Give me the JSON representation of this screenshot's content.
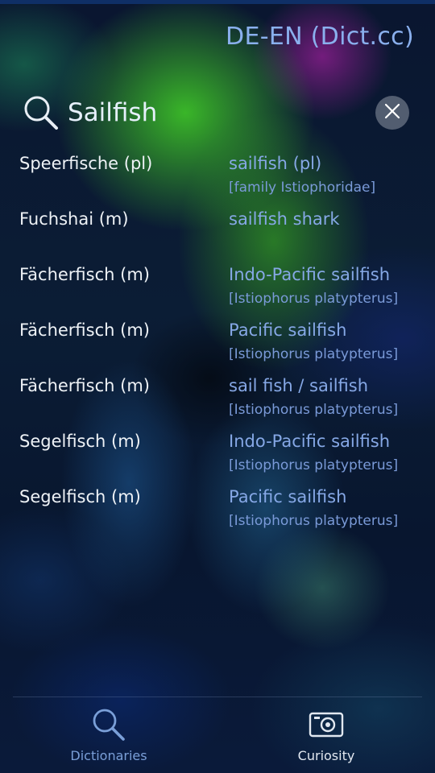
{
  "header": {
    "title": "DE-EN (Dict.cc)"
  },
  "search": {
    "query": "Sailfish"
  },
  "results": [
    {
      "de": "Speerfische (pl)",
      "en": "sailfish (pl)",
      "note": "[family Istiophoridae]"
    },
    {
      "de": "Fuchshai (m)",
      "en": "sailfish shark",
      "note": ""
    },
    {
      "de": "Fächerfisch (m)",
      "en": "Indo-Pacific sailfish",
      "note": "[Istiophorus platypterus]"
    },
    {
      "de": "Fächerfisch (m)",
      "en": "Pacific sailfish",
      "note": "[Istiophorus platypterus]"
    },
    {
      "de": "Fächerfisch (m)",
      "en": "sail fish / sailfish",
      "note": "[Istiophorus platypterus]"
    },
    {
      "de": "Segelfisch (m)",
      "en": "Indo-Pacific sailfish",
      "note": "[Istiophorus platypterus]"
    },
    {
      "de": "Segelfisch (m)",
      "en": "Pacific sailfish",
      "note": "[Istiophorus platypterus]"
    }
  ],
  "tabs": [
    {
      "label": "Dictionaries",
      "icon": "search-icon",
      "active": true
    },
    {
      "label": "Curiosity",
      "icon": "camera-icon",
      "active": false
    }
  ],
  "colors": {
    "accent": "#86a8e6",
    "primary_text": "#eef2f6"
  }
}
